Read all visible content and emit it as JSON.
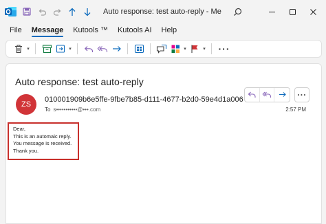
{
  "window": {
    "title": "Auto response: test auto-reply - Message (...",
    "icons": [
      "outlook-logo",
      "save-icon",
      "undo-icon",
      "redo-icon",
      "up-arrow-icon",
      "down-arrow-icon",
      "search-icon",
      "minimize-icon",
      "maximize-icon",
      "close-icon"
    ]
  },
  "menu": {
    "items": [
      {
        "label": "File",
        "active": false
      },
      {
        "label": "Message",
        "active": true
      },
      {
        "label": "Kutools ™",
        "active": false
      },
      {
        "label": "Kutools AI",
        "active": false
      },
      {
        "label": "Help",
        "active": false
      }
    ]
  },
  "ribbon": {
    "icons": [
      "delete-icon",
      "archive-icon",
      "move-icon",
      "reply-icon",
      "reply-all-icon",
      "forward-icon",
      "apps-icon",
      "read-aloud-icon",
      "categorize-icon",
      "flag-icon",
      "more-icon"
    ]
  },
  "message": {
    "subject": "Auto response: test auto-reply",
    "avatar_initials": "ZS",
    "avatar_color": "#d13438",
    "sender": "010001909b6e5ffe-9fbe7b85-d111-4677-b2d0-59e4d1a006",
    "to_label": "To",
    "to_address": "s•••••••••••@•••.com",
    "time": "2:57 PM",
    "body": {
      "lines": [
        "Dear,",
        "This is an automaic reply.",
        "You message is received.",
        "Thank you."
      ]
    },
    "highlight_color": "#c8302c"
  },
  "colors": {
    "accent": "#0f6cbd",
    "reply_purple": "#8764b8",
    "forward_blue": "#0f6cbd"
  }
}
